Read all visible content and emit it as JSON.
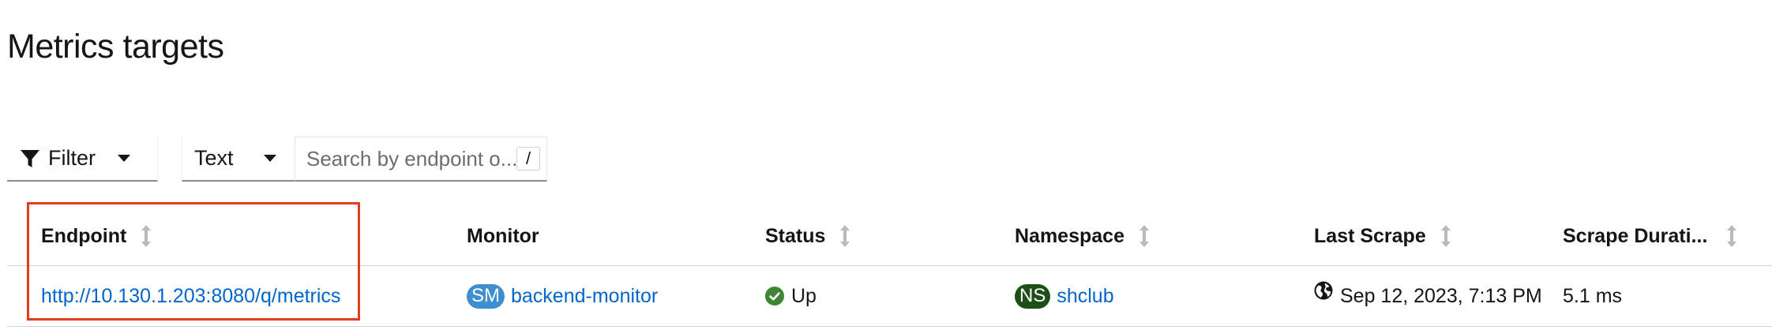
{
  "page": {
    "title": "Metrics targets"
  },
  "toolbar": {
    "filter_label": "Filter",
    "attribute_select_value": "Text",
    "search_placeholder": "Search by endpoint o...",
    "search_value": "",
    "shortcut_key": "/"
  },
  "table": {
    "columns": [
      {
        "label": "Endpoint",
        "sortable": true
      },
      {
        "label": "Monitor",
        "sortable": false
      },
      {
        "label": "Status",
        "sortable": true
      },
      {
        "label": "Namespace",
        "sortable": true
      },
      {
        "label": "Last Scrape",
        "sortable": true
      },
      {
        "label": "Scrape Durati...",
        "sortable": true
      }
    ],
    "rows": [
      {
        "endpoint": "http://10.130.1.203:8080/q/metrics",
        "monitor_badge": "SM",
        "monitor": "backend-monitor",
        "status": "Up",
        "namespace_badge": "NS",
        "namespace": "shclub",
        "last_scrape": "Sep 12, 2023, 7:13 PM",
        "scrape_duration": "5.1 ms"
      }
    ]
  },
  "icons": {
    "filter": "filter-funnel-icon",
    "caret": "caret-down-icon",
    "sort": "sort-arrows-icon",
    "status_up": "check-circle-icon",
    "last_scrape": "globe-icon"
  },
  "colors": {
    "link": "#0066cc",
    "monitor_badge": "#3e8ed0",
    "namespace_badge": "#1e4f18",
    "status_up": "#3e8635",
    "highlight": "#e43d1f"
  }
}
